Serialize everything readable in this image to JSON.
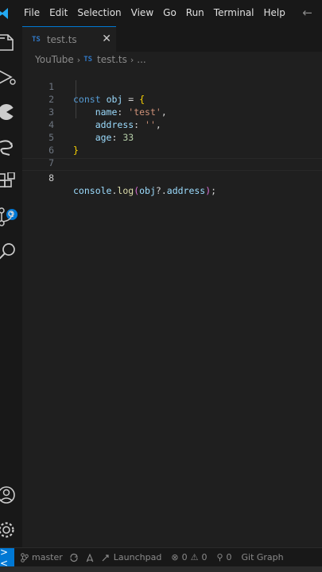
{
  "menubar": {
    "items": [
      "File",
      "Edit",
      "Selection",
      "View",
      "Go",
      "Run",
      "Terminal",
      "Help"
    ],
    "back_arrow": "←"
  },
  "activitybar": {
    "icons": [
      "explorer-icon",
      "run-debug-icon",
      "pie-extension-icon",
      "snake-extension-icon",
      "extensions-icon",
      "source-control-icon",
      "search-icon",
      "account-icon",
      "settings-icon"
    ],
    "extensions_badge": "1"
  },
  "tab": {
    "lang_badge": "TS",
    "label": "test.ts",
    "close": "✕"
  },
  "breadcrumb": {
    "folder": "YouTube",
    "lang_badge": "TS",
    "file": "test.ts",
    "more": "..."
  },
  "editor": {
    "line_numbers": [
      "1",
      "2",
      "3",
      "4",
      "5",
      "6",
      "7",
      "8"
    ],
    "tokens": {
      "l1": [
        "const",
        "obj",
        "=",
        "{"
      ],
      "l2": [
        "name",
        ":",
        "'test'",
        ","
      ],
      "l3": [
        "address",
        ":",
        "''",
        ","
      ],
      "l4": [
        "age",
        ":",
        "33"
      ],
      "l5": [
        "}"
      ],
      "l8": [
        "console",
        ".",
        "log",
        "(",
        "obj",
        "?.",
        "address",
        ")",
        ";"
      ]
    }
  },
  "statusbar": {
    "remote": "><",
    "branch": "master",
    "launchpad": "Launchpad",
    "errors": "0",
    "warnings": "0",
    "ports": "0",
    "git_graph": "Git Graph"
  },
  "colors": {
    "accent": "#0078d4",
    "background": "#1f1f1f",
    "keyword": "#c586c0",
    "string": "#ce9178",
    "number": "#b5cea8"
  }
}
